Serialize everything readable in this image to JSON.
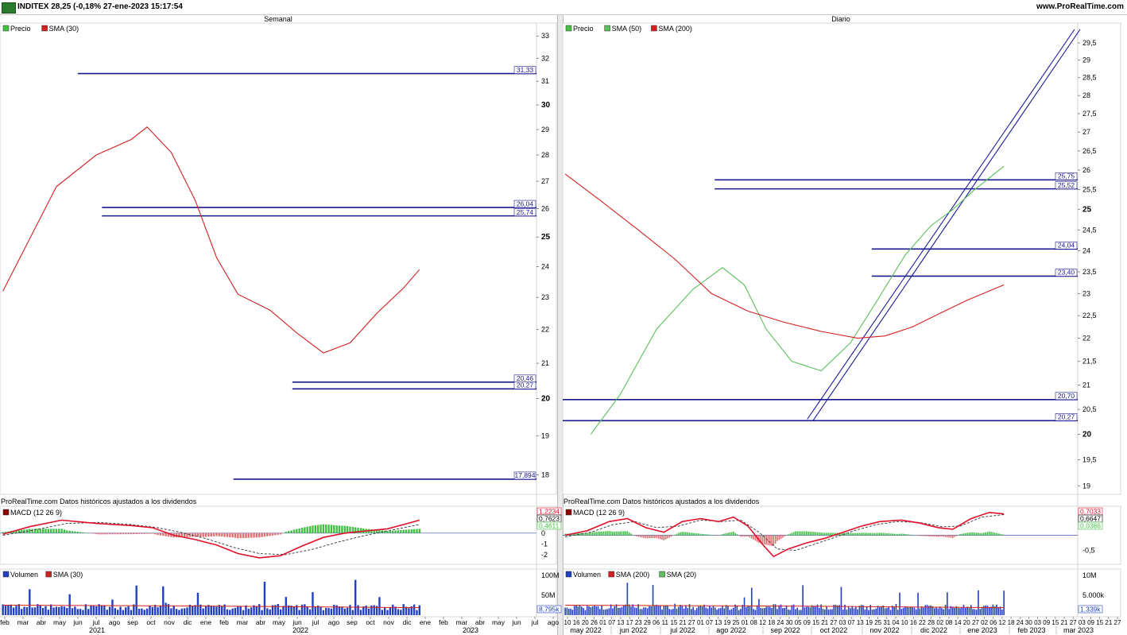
{
  "header": {
    "title": "INDITEX 28,25 (-0,18% 27-ene-2023 15:17:54",
    "site": "www.ProRealTime.com"
  },
  "panels": {
    "left_title": "Semanal",
    "right_title": "Diario",
    "source_note": "ProRealTime.com Datos históricos ajustados a los dividendos"
  },
  "colors": {
    "up": "#44c144",
    "down": "#e07070",
    "sma_red": "#d42020",
    "sma_green": "#5cc05c",
    "level_line": "#1a1a8c",
    "macd_line": "#e0102a",
    "signal_line": "#333333",
    "volume": "#2040c0",
    "channel": "#1a1a9c"
  },
  "chart_data": [
    {
      "id": "weekly-price",
      "type": "candlestick",
      "title": "Semanal",
      "legend": [
        {
          "name": "Precio",
          "color": "#44c144"
        },
        {
          "name": "SMA (30)",
          "color": "#d42020"
        }
      ],
      "ylim": [
        17.6,
        33.3
      ],
      "y_scale": "log",
      "y_ticks": [
        "18",
        "19",
        "20",
        "21",
        "22",
        "23",
        "24",
        "25",
        "26",
        "27",
        "28",
        "29",
        "30",
        "31",
        "32",
        "33"
      ],
      "y_ticks_bold": [
        "20",
        "25",
        "30"
      ],
      "levels": [
        {
          "label": "31,33",
          "y": 31.33,
          "x_from": 0.145
        },
        {
          "label": "26,04",
          "y": 26.04,
          "x_from": 0.19
        },
        {
          "label": "25,74",
          "y": 25.74,
          "x_from": 0.19
        },
        {
          "label": "20,46",
          "y": 20.46,
          "x_from": 0.545
        },
        {
          "label": "20,27",
          "y": 20.27,
          "x_from": 0.545
        },
        {
          "label": "17,894",
          "y": 17.894,
          "x_from": 0.435
        }
      ],
      "anchors": [
        [
          0,
          23.0
        ],
        [
          8,
          26.5
        ],
        [
          16,
          28.0
        ],
        [
          25,
          31.0
        ],
        [
          30,
          29.2
        ],
        [
          36,
          26.5
        ],
        [
          42,
          29.0
        ],
        [
          49,
          29.8
        ],
        [
          54,
          30.6
        ],
        [
          58,
          29.4
        ],
        [
          65,
          26.5
        ],
        [
          72,
          25.6
        ],
        [
          76,
          25.0
        ],
        [
          82,
          21.2
        ],
        [
          86,
          19.0
        ],
        [
          92,
          19.7
        ],
        [
          97,
          20.2
        ],
        [
          102,
          21.5
        ],
        [
          107,
          23.0
        ],
        [
          112,
          24.4
        ],
        [
          118,
          24.9
        ],
        [
          120,
          22.8
        ],
        [
          124,
          21.0
        ],
        [
          129,
          21.5
        ],
        [
          134,
          22.6
        ],
        [
          139,
          23.8
        ],
        [
          144,
          24.6
        ],
        [
          149,
          25.2
        ],
        [
          151,
          25.4
        ],
        [
          153,
          26.6
        ],
        [
          156,
          27.9
        ]
      ],
      "sma": [
        [
          0,
          23.2
        ],
        [
          20,
          26.8
        ],
        [
          35,
          28.0
        ],
        [
          48,
          28.6
        ],
        [
          54,
          29.1
        ],
        [
          63,
          28.1
        ],
        [
          72,
          26.3
        ],
        [
          80,
          24.3
        ],
        [
          88,
          23.1
        ],
        [
          100,
          22.6
        ],
        [
          110,
          21.9
        ],
        [
          120,
          21.3
        ],
        [
          130,
          21.6
        ],
        [
          140,
          22.5
        ],
        [
          150,
          23.3
        ],
        [
          156,
          23.9
        ]
      ],
      "x_ticks": [
        "feb",
        "mar",
        "abr",
        "may",
        "jun",
        "jul",
        "ago",
        "sep",
        "oct",
        "nov",
        "dic",
        "ene",
        "feb",
        "mar",
        "abr",
        "may",
        "jun",
        "jul",
        "ago",
        "sep",
        "oct",
        "nov",
        "dic",
        "ene",
        "feb",
        "mar",
        "abr",
        "may",
        "jun",
        "jul",
        "ago"
      ],
      "x_years": [
        "2021",
        "2022",
        "2023"
      ]
    },
    {
      "id": "weekly-macd",
      "type": "line",
      "title": "MACD (12 26 9)",
      "ylim": [
        -2.6,
        2.2
      ],
      "y_ticks": [
        "-2",
        "-1",
        "0",
        "1",
        "2"
      ],
      "value_labels": [
        "1,2234",
        "0,7623",
        "0,4611"
      ],
      "macd": [
        [
          0,
          -0.1
        ],
        [
          10,
          0.6
        ],
        [
          22,
          1.2
        ],
        [
          35,
          0.9
        ],
        [
          48,
          0.7
        ],
        [
          56,
          0.5
        ],
        [
          64,
          -0.2
        ],
        [
          72,
          -0.6
        ],
        [
          80,
          -1.1
        ],
        [
          88,
          -1.9
        ],
        [
          96,
          -2.3
        ],
        [
          104,
          -2.1
        ],
        [
          112,
          -1.2
        ],
        [
          120,
          -0.4
        ],
        [
          128,
          0.0
        ],
        [
          136,
          0.2
        ],
        [
          144,
          0.4
        ],
        [
          150,
          0.8
        ],
        [
          156,
          1.2
        ]
      ],
      "signal": [
        [
          0,
          -0.2
        ],
        [
          12,
          0.3
        ],
        [
          24,
          0.9
        ],
        [
          36,
          1.0
        ],
        [
          48,
          0.8
        ],
        [
          58,
          0.5
        ],
        [
          66,
          0.1
        ],
        [
          76,
          -0.5
        ],
        [
          86,
          -1.3
        ],
        [
          96,
          -1.9
        ],
        [
          106,
          -2.0
        ],
        [
          116,
          -1.5
        ],
        [
          126,
          -0.8
        ],
        [
          136,
          -0.2
        ],
        [
          146,
          0.3
        ],
        [
          156,
          0.8
        ]
      ]
    },
    {
      "id": "weekly-volume",
      "type": "bar",
      "title": "Volumen",
      "legend": [
        {
          "name": "Volumen",
          "color": "#2040c0"
        },
        {
          "name": "SMA (30)",
          "color": "#d42020"
        }
      ],
      "ylim": [
        0,
        100
      ],
      "y_ticks": [
        "100M",
        "50M"
      ],
      "value_label": "8,795k"
    },
    {
      "id": "daily-price",
      "type": "candlestick",
      "title": "Diario",
      "legend": [
        {
          "name": "Precio",
          "color": "#44c144"
        },
        {
          "name": "SMA (50)",
          "color": "#5cc05c"
        },
        {
          "name": "SMA (200)",
          "color": "#d42020"
        }
      ],
      "ylim": [
        18.9,
        29.9
      ],
      "y_scale": "log",
      "y_ticks": [
        "19",
        "19,5",
        "20",
        "20,5",
        "21",
        "21,5",
        "22",
        "22,5",
        "23",
        "23,5",
        "24",
        "24,5",
        "25",
        "25,5",
        "26",
        "26,5",
        "27",
        "27,5",
        "28",
        "28,5",
        "29",
        "29,5"
      ],
      "y_ticks_bold": [
        "20",
        "25"
      ],
      "levels": [
        {
          "label": "25,75",
          "y": 25.75,
          "x_from": 0.295
        },
        {
          "label": "25,52",
          "y": 25.52,
          "x_from": 0.295
        },
        {
          "label": "24,04",
          "y": 24.04,
          "x_from": 0.6
        },
        {
          "label": "23,40",
          "y": 23.4,
          "x_from": 0.6
        },
        {
          "label": "20,70",
          "y": 20.7,
          "x_from": 0.0
        },
        {
          "label": "20,27",
          "y": 20.27,
          "x_from": 0.0
        }
      ],
      "channel": [
        [
          0.475,
          20.3
        ],
        [
          1.0,
          29.9
        ]
      ],
      "anchors": [
        [
          0,
          20.0
        ],
        [
          6,
          19.4
        ],
        [
          14,
          20.3
        ],
        [
          22,
          21.6
        ],
        [
          30,
          22.2
        ],
        [
          38,
          21.3
        ],
        [
          46,
          21.8
        ],
        [
          54,
          22.8
        ],
        [
          62,
          24.4
        ],
        [
          70,
          23.4
        ],
        [
          78,
          23.6
        ],
        [
          86,
          24.6
        ],
        [
          92,
          25.5
        ],
        [
          98,
          24.6
        ],
        [
          104,
          22.0
        ],
        [
          110,
          20.9
        ],
        [
          116,
          22.2
        ],
        [
          122,
          21.2
        ],
        [
          128,
          21.0
        ],
        [
          134,
          20.6
        ],
        [
          140,
          21.6
        ],
        [
          146,
          21.3
        ],
        [
          152,
          22.6
        ],
        [
          160,
          23.0
        ],
        [
          168,
          24.0
        ],
        [
          176,
          24.6
        ],
        [
          182,
          24.3
        ],
        [
          188,
          25.2
        ],
        [
          194,
          24.6
        ],
        [
          200,
          25.2
        ],
        [
          206,
          24.8
        ],
        [
          212,
          25.6
        ],
        [
          218,
          27.0
        ],
        [
          224,
          27.5
        ],
        [
          230,
          27.0
        ],
        [
          236,
          27.8
        ],
        [
          240,
          28.3
        ]
      ],
      "sma50": [
        [
          14,
          20.0
        ],
        [
          30,
          20.8
        ],
        [
          50,
          22.2
        ],
        [
          70,
          23.1
        ],
        [
          86,
          23.6
        ],
        [
          98,
          23.2
        ],
        [
          110,
          22.2
        ],
        [
          124,
          21.5
        ],
        [
          140,
          21.3
        ],
        [
          156,
          21.9
        ],
        [
          170,
          22.8
        ],
        [
          186,
          23.9
        ],
        [
          200,
          24.6
        ],
        [
          212,
          25.0
        ],
        [
          224,
          25.5
        ],
        [
          240,
          26.1
        ]
      ],
      "sma200": [
        [
          0,
          25.9
        ],
        [
          20,
          25.2
        ],
        [
          40,
          24.5
        ],
        [
          60,
          23.8
        ],
        [
          80,
          23.0
        ],
        [
          100,
          22.6
        ],
        [
          120,
          22.35
        ],
        [
          140,
          22.15
        ],
        [
          160,
          22.0
        ],
        [
          175,
          22.05
        ],
        [
          190,
          22.25
        ],
        [
          205,
          22.55
        ],
        [
          220,
          22.85
        ],
        [
          240,
          23.2
        ]
      ],
      "x_ticks": [
        "10",
        "16",
        "20",
        "26",
        "01",
        "07",
        "13",
        "17",
        "23",
        "29",
        "06",
        "11",
        "15",
        "21",
        "27",
        "01",
        "07",
        "13",
        "19",
        "25",
        "01",
        "08",
        "12",
        "18",
        "24",
        "30",
        "05",
        "09",
        "15",
        "21",
        "27",
        "03",
        "07",
        "13",
        "19",
        "25",
        "31",
        "04",
        "10",
        "16",
        "22",
        "28",
        "02",
        "08",
        "14",
        "20",
        "27",
        "02",
        "06",
        "12",
        "18",
        "24",
        "30",
        "03",
        "09",
        "15",
        "21",
        "27",
        "03",
        "09",
        "15",
        "21",
        "27"
      ],
      "x_months": [
        "may 2022",
        "jun 2022",
        "jul 2022",
        "ago 2022",
        "sep 2022",
        "oct 2022",
        "nov 2022",
        "dic 2022",
        "ene 2023",
        "feb 2023",
        "mar 2023"
      ]
    },
    {
      "id": "daily-macd",
      "type": "line",
      "title": "MACD (12 26 9)",
      "ylim": [
        -0.85,
        0.85
      ],
      "y_ticks": [
        "-0,5"
      ],
      "value_labels": [
        "0,7033",
        "0,6647",
        "0,0386"
      ],
      "macd": [
        [
          0,
          0.0
        ],
        [
          12,
          0.15
        ],
        [
          24,
          0.45
        ],
        [
          34,
          0.55
        ],
        [
          44,
          0.25
        ],
        [
          54,
          0.1
        ],
        [
          64,
          0.45
        ],
        [
          74,
          0.55
        ],
        [
          84,
          0.45
        ],
        [
          92,
          0.6
        ],
        [
          100,
          0.3
        ],
        [
          108,
          -0.3
        ],
        [
          114,
          -0.7
        ],
        [
          122,
          -0.45
        ],
        [
          132,
          -0.25
        ],
        [
          142,
          -0.1
        ],
        [
          152,
          0.1
        ],
        [
          162,
          0.3
        ],
        [
          172,
          0.45
        ],
        [
          184,
          0.5
        ],
        [
          194,
          0.4
        ],
        [
          204,
          0.25
        ],
        [
          212,
          0.2
        ],
        [
          222,
          0.55
        ],
        [
          232,
          0.75
        ],
        [
          240,
          0.7
        ]
      ],
      "signal": [
        [
          0,
          -0.05
        ],
        [
          14,
          0.1
        ],
        [
          26,
          0.35
        ],
        [
          38,
          0.45
        ],
        [
          50,
          0.25
        ],
        [
          62,
          0.3
        ],
        [
          74,
          0.5
        ],
        [
          86,
          0.45
        ],
        [
          96,
          0.5
        ],
        [
          106,
          0.1
        ],
        [
          116,
          -0.45
        ],
        [
          126,
          -0.5
        ],
        [
          136,
          -0.3
        ],
        [
          146,
          -0.1
        ],
        [
          158,
          0.15
        ],
        [
          170,
          0.35
        ],
        [
          182,
          0.45
        ],
        [
          194,
          0.42
        ],
        [
          206,
          0.28
        ],
        [
          216,
          0.3
        ],
        [
          228,
          0.6
        ],
        [
          240,
          0.68
        ]
      ]
    },
    {
      "id": "daily-volume",
      "type": "bar",
      "title": "Volumen",
      "legend": [
        {
          "name": "Volumen",
          "color": "#2040c0"
        },
        {
          "name": "SMA (200)",
          "color": "#d42020"
        },
        {
          "name": "SMA (20)",
          "color": "#5cc05c"
        }
      ],
      "ylim": [
        0,
        12
      ],
      "y_ticks": [
        "10M",
        "5.000k"
      ],
      "value_label": "1.339k"
    }
  ]
}
